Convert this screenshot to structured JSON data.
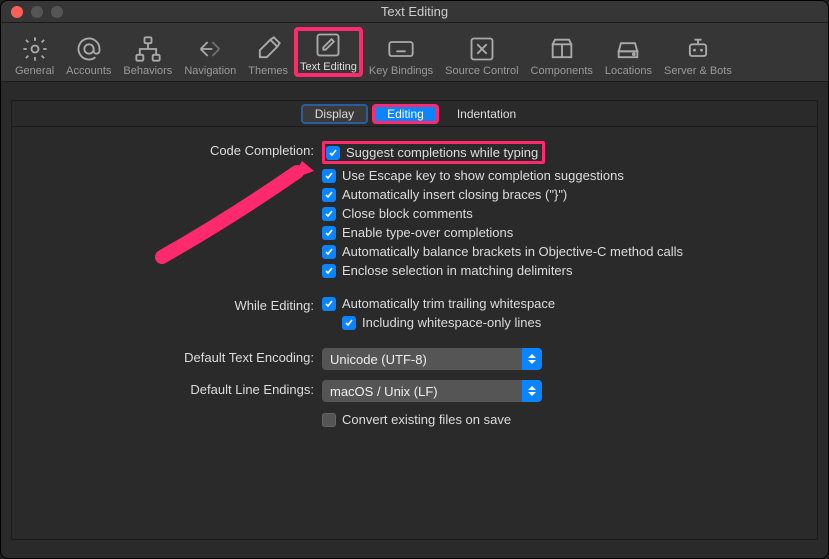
{
  "window": {
    "title": "Text Editing"
  },
  "toolbar": {
    "items": [
      {
        "id": "general",
        "label": "General"
      },
      {
        "id": "accounts",
        "label": "Accounts"
      },
      {
        "id": "behaviors",
        "label": "Behaviors"
      },
      {
        "id": "navigation",
        "label": "Navigation"
      },
      {
        "id": "themes",
        "label": "Themes"
      },
      {
        "id": "text-editing",
        "label": "Text Editing"
      },
      {
        "id": "key-bindings",
        "label": "Key Bindings"
      },
      {
        "id": "source-control",
        "label": "Source Control"
      },
      {
        "id": "components",
        "label": "Components"
      },
      {
        "id": "locations",
        "label": "Locations"
      },
      {
        "id": "server-bots",
        "label": "Server & Bots"
      }
    ]
  },
  "tabs": {
    "display": "Display",
    "editing": "Editing",
    "indentation": "Indentation"
  },
  "sections": {
    "code_completion": {
      "label": "Code Completion:",
      "opts": [
        "Suggest completions while typing",
        "Use Escape key to show completion suggestions",
        "Automatically insert closing braces (\"}\")",
        "Close block comments",
        "Enable type-over completions",
        "Automatically balance brackets in Objective-C method calls",
        "Enclose selection in matching delimiters"
      ]
    },
    "while_editing": {
      "label": "While Editing:",
      "opt1": "Automatically trim trailing whitespace",
      "opt2": "Including whitespace-only lines"
    },
    "encoding": {
      "label": "Default Text Encoding:",
      "value": "Unicode (UTF-8)"
    },
    "line_endings": {
      "label": "Default Line Endings:",
      "value": "macOS / Unix (LF)",
      "convert": "Convert existing files on save"
    }
  }
}
